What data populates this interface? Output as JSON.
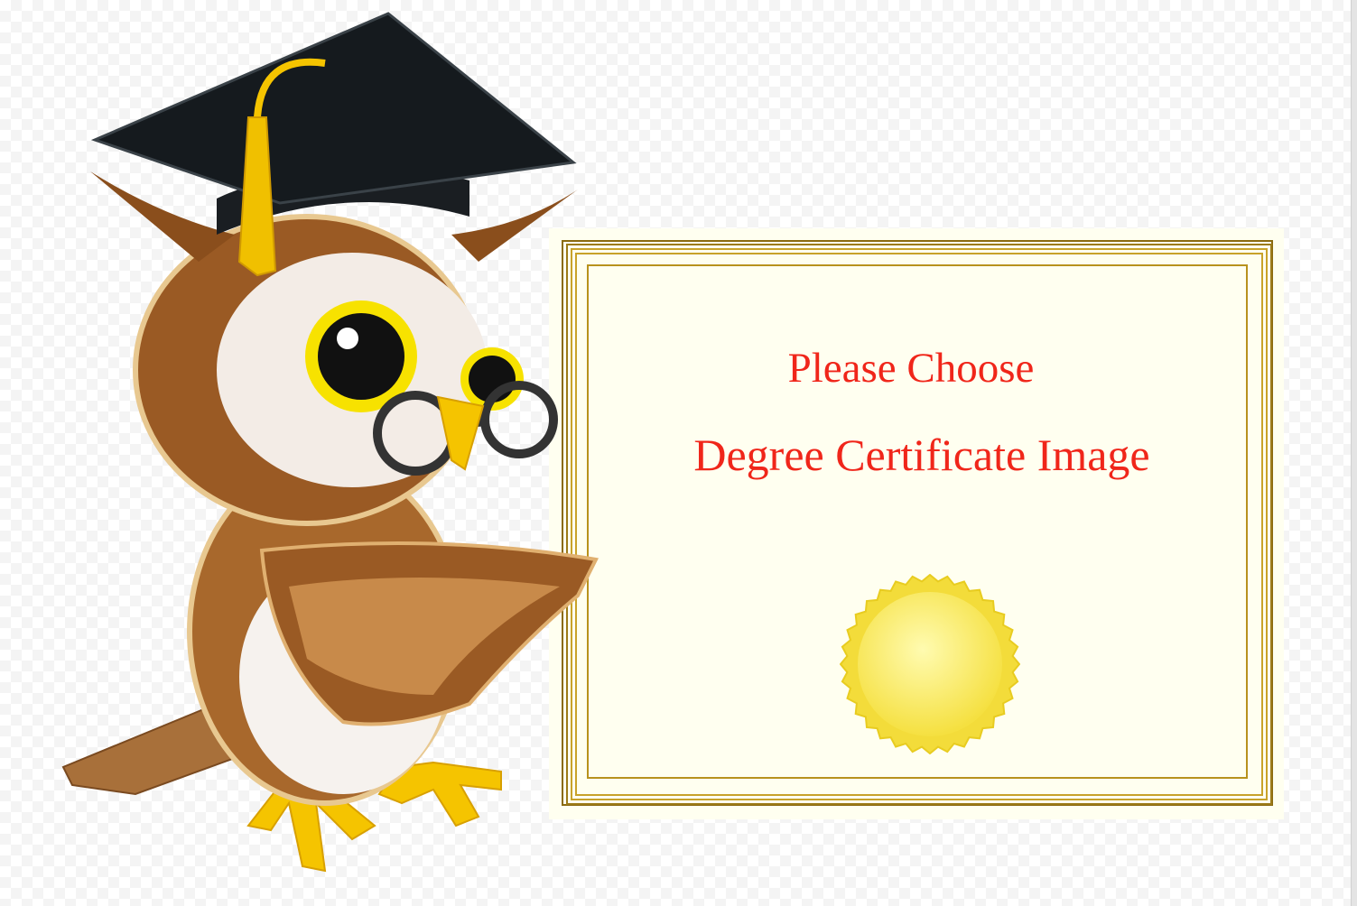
{
  "certificate": {
    "line1": "Please Choose",
    "line2": "Degree Certificate Image",
    "text_color": "#f0261a",
    "background_color": "#fffff0",
    "border_color": "#c8a22a"
  },
  "icons": {
    "owl": "owl-illustration-icon",
    "seal": "gold-seal-icon"
  }
}
